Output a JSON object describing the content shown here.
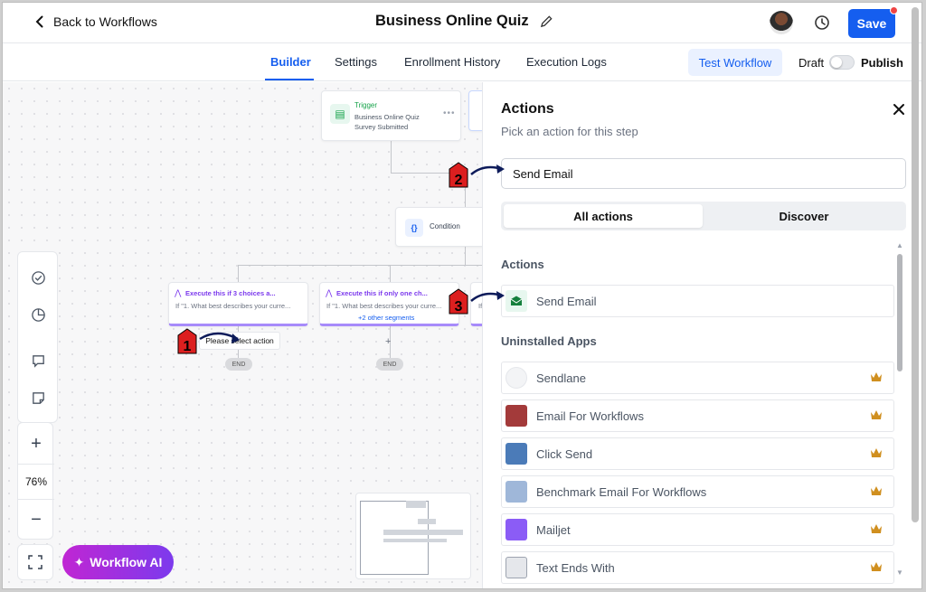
{
  "header": {
    "back_label": "Back to Workflows",
    "title": "Business Online Quiz",
    "save_label": "Save"
  },
  "tabs": [
    {
      "label": "Builder",
      "active": true
    },
    {
      "label": "Settings",
      "active": false
    },
    {
      "label": "Enrollment History",
      "active": false
    },
    {
      "label": "Execution Logs",
      "active": false
    }
  ],
  "toolbar": {
    "test_label": "Test Workflow",
    "draft_label": "Draft",
    "publish_label": "Publish",
    "publish_on": false
  },
  "canvas": {
    "trigger": {
      "label": "Trigger",
      "line1": "Business Online Quiz",
      "line2": "Survey Submitted"
    },
    "condition": {
      "label": "Condition",
      "icon": "{}"
    },
    "branches": [
      {
        "title": "Execute this if 3 choices a...",
        "sub": "If \"1. What best describes your curre...",
        "link": ""
      },
      {
        "title": "Execute this if only one ch...",
        "sub": "If \"1. What best describes your curre...",
        "link": "+2 other segments"
      },
      {
        "title": "",
        "sub": "If",
        "link": ""
      }
    ],
    "select_action": "Please select action",
    "end_label": "END",
    "zoom": "76%",
    "ai_label": "Workflow AI"
  },
  "panel": {
    "title": "Actions",
    "subtitle": "Pick an action for this step",
    "search_value": "Send Email",
    "segments": [
      "All actions",
      "Discover"
    ],
    "actions_label": "Actions",
    "actions": [
      {
        "label": "Send Email",
        "icon": "envelope-icon"
      }
    ],
    "uninstalled_label": "Uninstalled Apps",
    "apps": [
      {
        "label": "Sendlane",
        "icon": "sendlane-logo-icon",
        "color": "#f3f4f6"
      },
      {
        "label": "Email For Workflows",
        "icon": "email-workflows-logo-icon",
        "color": "#a33a3a"
      },
      {
        "label": "Click Send",
        "icon": "clicksend-logo-icon",
        "color": "#4b7bb8"
      },
      {
        "label": "Benchmark Email For Workflows",
        "icon": "benchmark-logo-icon",
        "color": "#9fb7d9"
      },
      {
        "label": "Mailjet",
        "icon": "mailjet-logo-icon",
        "color": "#8b5cf6"
      },
      {
        "label": "Text Ends With",
        "icon": "text-ends-logo-icon",
        "color": "#e5e7eb"
      }
    ]
  },
  "annotations": [
    "1",
    "2",
    "3"
  ],
  "colors": {
    "primary": "#155eef",
    "ai_gradient_start": "#c026d3",
    "ai_gradient_end": "#7c3aed",
    "annotation": "#dc1f1f"
  }
}
